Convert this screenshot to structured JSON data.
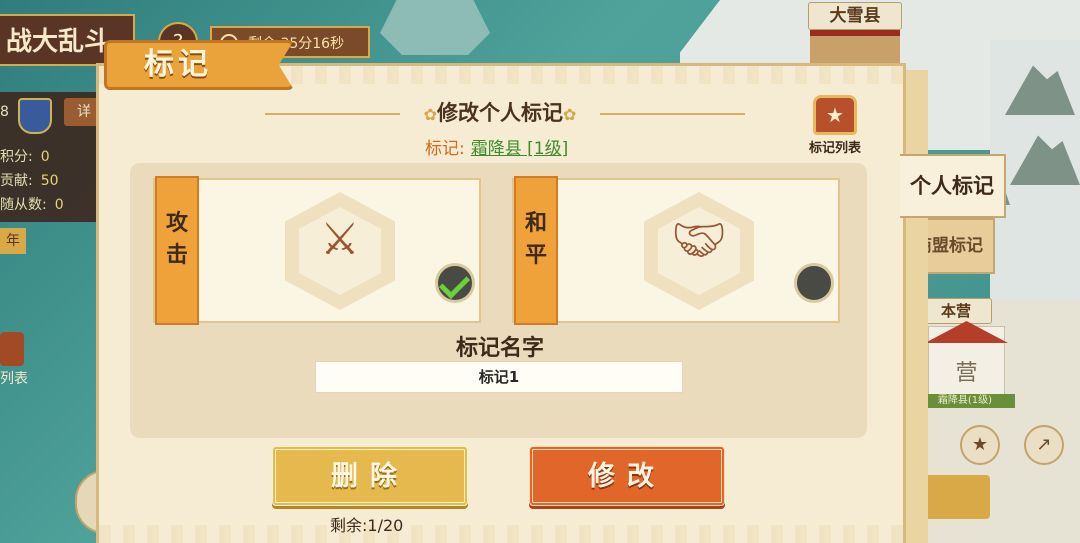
{
  "map": {
    "county_label": "大雪县",
    "home_base_label": "本营",
    "camp_sign": "营",
    "camp_subtext": "霜降县(1级)"
  },
  "hud": {
    "title": "战大乱斗",
    "help_icon": "?",
    "timer": "剩余 35分16秒",
    "shield_label": "8",
    "detail_button": "详",
    "stats": [
      {
        "label": "积分:",
        "value": "0"
      },
      {
        "label": "贡献:",
        "value": "50"
      },
      {
        "label": "随从数:",
        "value": "0"
      }
    ],
    "small_button": "年",
    "list_label": "列表"
  },
  "popup": {
    "title": "标记",
    "subtitle": "修改个人标记",
    "mark_key": "标记:",
    "mark_value": "霜降县 [1级]",
    "list_button_label": "标记列表",
    "tabs": [
      {
        "label": "个人标记",
        "active": true
      },
      {
        "label": "商盟标记",
        "active": false
      }
    ],
    "choices": [
      {
        "label": "攻击",
        "icon": "crossed-swords-icon",
        "selected": true
      },
      {
        "label": "和平",
        "icon": "handshake-icon",
        "selected": false
      }
    ],
    "name_label": "标记名字",
    "name_input_value": "标记1",
    "delete_button": "删除",
    "modify_button": "修改",
    "remaining": "剩余:1/20"
  },
  "colors": {
    "accent_orange": "#e0662a",
    "accent_gold": "#e6b94e",
    "check_green": "#6bd03a",
    "parchment": "#f6ecd4"
  }
}
